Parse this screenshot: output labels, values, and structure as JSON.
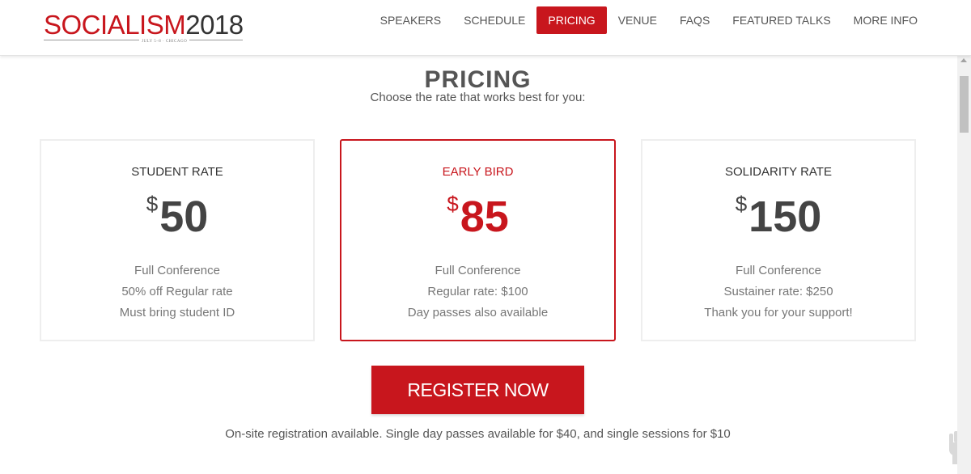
{
  "header": {
    "logo": {
      "word1": "SOCIALISM",
      "word2": "2018",
      "tagline": "JULY 5–8 · CHICAGO"
    },
    "nav": [
      {
        "label": "SPEAKERS",
        "active": false
      },
      {
        "label": "SCHEDULE",
        "active": false
      },
      {
        "label": "PRICING",
        "active": true
      },
      {
        "label": "VENUE",
        "active": false
      },
      {
        "label": "FAQS",
        "active": false
      },
      {
        "label": "FEATURED TALKS",
        "active": false
      },
      {
        "label": "MORE INFO",
        "active": false
      }
    ]
  },
  "pricing": {
    "title": "PRICING",
    "subtitle": "Choose the rate that works best for you:",
    "cards": [
      {
        "name": "STUDENT RATE",
        "currency": "$",
        "amount": "50",
        "lines": [
          "Full Conference",
          "50% off Regular rate",
          "Must bring student ID"
        ]
      },
      {
        "name": "EARLY BIRD",
        "currency": "$",
        "amount": "85",
        "lines": [
          "Full Conference",
          "Regular rate: $100",
          "Day passes also available"
        ]
      },
      {
        "name": "SOLIDARITY RATE",
        "currency": "$",
        "amount": "150",
        "lines": [
          "Full Conference",
          "Sustainer rate: $250",
          "Thank you for your support!"
        ]
      }
    ],
    "register_label": "REGISTER NOW",
    "footer_note": "On-site registration available. Single day passes available for $40, and single sessions for $10"
  },
  "colors": {
    "accent": "#c8161d",
    "text": "#555555",
    "muted": "#777777"
  },
  "icons": {
    "corner": "raised-fist-icon"
  }
}
